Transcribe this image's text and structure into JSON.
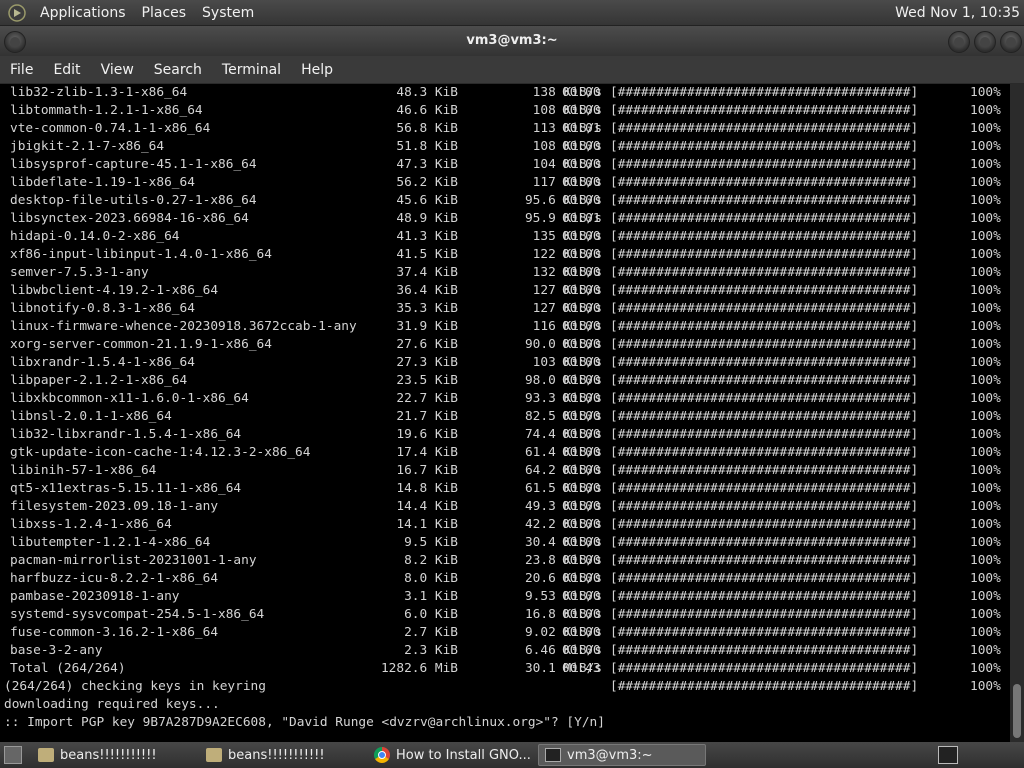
{
  "top_panel": {
    "menus": [
      "Applications",
      "Places",
      "System"
    ],
    "clock": "Wed Nov 1, 10:35"
  },
  "window": {
    "title": "vm3@vm3:~"
  },
  "menubar": {
    "items": [
      "File",
      "Edit",
      "View",
      "Search",
      "Terminal",
      "Help"
    ]
  },
  "terminal": {
    "rows": [
      {
        "pkg": "lib32-zlib-1.3-1-x86_64",
        "size": "48.3 KiB",
        "rate": "138 KiB/s",
        "eta": "00:00",
        "bar": "[######################################]",
        "pct": "100%"
      },
      {
        "pkg": "libtommath-1.2.1-1-x86_64",
        "size": "46.6 KiB",
        "rate": "108 KiB/s",
        "eta": "00:00",
        "bar": "[######################################]",
        "pct": "100%"
      },
      {
        "pkg": "vte-common-0.74.1-1-x86_64",
        "size": "56.8 KiB",
        "rate": "113 KiB/s",
        "eta": "00:01",
        "bar": "[######################################]",
        "pct": "100%"
      },
      {
        "pkg": "jbigkit-2.1-7-x86_64",
        "size": "51.8 KiB",
        "rate": "108 KiB/s",
        "eta": "00:00",
        "bar": "[######################################]",
        "pct": "100%"
      },
      {
        "pkg": "libsysprof-capture-45.1-1-x86_64",
        "size": "47.3 KiB",
        "rate": "104 KiB/s",
        "eta": "00:00",
        "bar": "[######################################]",
        "pct": "100%"
      },
      {
        "pkg": "libdeflate-1.19-1-x86_64",
        "size": "56.2 KiB",
        "rate": "117 KiB/s",
        "eta": "00:00",
        "bar": "[######################################]",
        "pct": "100%"
      },
      {
        "pkg": "desktop-file-utils-0.27-1-x86_64",
        "size": "45.6 KiB",
        "rate": "95.6 KiB/s",
        "eta": "00:00",
        "bar": "[######################################]",
        "pct": "100%"
      },
      {
        "pkg": "libsynctex-2023.66984-16-x86_64",
        "size": "48.9 KiB",
        "rate": "95.9 KiB/s",
        "eta": "00:01",
        "bar": "[######################################]",
        "pct": "100%"
      },
      {
        "pkg": "hidapi-0.14.0-2-x86_64",
        "size": "41.3 KiB",
        "rate": "135 KiB/s",
        "eta": "00:00",
        "bar": "[######################################]",
        "pct": "100%"
      },
      {
        "pkg": "xf86-input-libinput-1.4.0-1-x86_64",
        "size": "41.5 KiB",
        "rate": "122 KiB/s",
        "eta": "00:00",
        "bar": "[######################################]",
        "pct": "100%"
      },
      {
        "pkg": "semver-7.5.3-1-any",
        "size": "37.4 KiB",
        "rate": "132 KiB/s",
        "eta": "00:00",
        "bar": "[######################################]",
        "pct": "100%"
      },
      {
        "pkg": "libwbclient-4.19.2-1-x86_64",
        "size": "36.4 KiB",
        "rate": "127 KiB/s",
        "eta": "00:00",
        "bar": "[######################################]",
        "pct": "100%"
      },
      {
        "pkg": "libnotify-0.8.3-1-x86_64",
        "size": "35.3 KiB",
        "rate": "127 KiB/s",
        "eta": "00:00",
        "bar": "[######################################]",
        "pct": "100%"
      },
      {
        "pkg": "linux-firmware-whence-20230918.3672ccab-1-any",
        "size": "31.9 KiB",
        "rate": "116 KiB/s",
        "eta": "00:00",
        "bar": "[######################################]",
        "pct": "100%"
      },
      {
        "pkg": "xorg-server-common-21.1.9-1-x86_64",
        "size": "27.6 KiB",
        "rate": "90.0 KiB/s",
        "eta": "00:00",
        "bar": "[######################################]",
        "pct": "100%"
      },
      {
        "pkg": "libxrandr-1.5.4-1-x86_64",
        "size": "27.3 KiB",
        "rate": "103 KiB/s",
        "eta": "00:00",
        "bar": "[######################################]",
        "pct": "100%"
      },
      {
        "pkg": "libpaper-2.1.2-1-x86_64",
        "size": "23.5 KiB",
        "rate": "98.0 KiB/s",
        "eta": "00:00",
        "bar": "[######################################]",
        "pct": "100%"
      },
      {
        "pkg": "libxkbcommon-x11-1.6.0-1-x86_64",
        "size": "22.7 KiB",
        "rate": "93.3 KiB/s",
        "eta": "00:00",
        "bar": "[######################################]",
        "pct": "100%"
      },
      {
        "pkg": "libnsl-2.0.1-1-x86_64",
        "size": "21.7 KiB",
        "rate": "82.5 KiB/s",
        "eta": "00:00",
        "bar": "[######################################]",
        "pct": "100%"
      },
      {
        "pkg": "lib32-libxrandr-1.5.4-1-x86_64",
        "size": "19.6 KiB",
        "rate": "74.4 KiB/s",
        "eta": "00:00",
        "bar": "[######################################]",
        "pct": "100%"
      },
      {
        "pkg": "gtk-update-icon-cache-1:4.12.3-2-x86_64",
        "size": "17.4 KiB",
        "rate": "61.4 KiB/s",
        "eta": "00:00",
        "bar": "[######################################]",
        "pct": "100%"
      },
      {
        "pkg": "libinih-57-1-x86_64",
        "size": "16.7 KiB",
        "rate": "64.2 KiB/s",
        "eta": "00:00",
        "bar": "[######################################]",
        "pct": "100%"
      },
      {
        "pkg": "qt5-x11extras-5.15.11-1-x86_64",
        "size": "14.8 KiB",
        "rate": "61.5 KiB/s",
        "eta": "00:00",
        "bar": "[######################################]",
        "pct": "100%"
      },
      {
        "pkg": "filesystem-2023.09.18-1-any",
        "size": "14.4 KiB",
        "rate": "49.3 KiB/s",
        "eta": "00:00",
        "bar": "[######################################]",
        "pct": "100%"
      },
      {
        "pkg": "libxss-1.2.4-1-x86_64",
        "size": "14.1 KiB",
        "rate": "42.2 KiB/s",
        "eta": "00:00",
        "bar": "[######################################]",
        "pct": "100%"
      },
      {
        "pkg": "libutempter-1.2.1-4-x86_64",
        "size": "9.5 KiB",
        "rate": "30.4 KiB/s",
        "eta": "00:00",
        "bar": "[######################################]",
        "pct": "100%"
      },
      {
        "pkg": "pacman-mirrorlist-20231001-1-any",
        "size": "8.2 KiB",
        "rate": "23.8 KiB/s",
        "eta": "00:00",
        "bar": "[######################################]",
        "pct": "100%"
      },
      {
        "pkg": "harfbuzz-icu-8.2.2-1-x86_64",
        "size": "8.0 KiB",
        "rate": "20.6 KiB/s",
        "eta": "00:00",
        "bar": "[######################################]",
        "pct": "100%"
      },
      {
        "pkg": "pambase-20230918-1-any",
        "size": "3.1 KiB",
        "rate": "9.53 KiB/s",
        "eta": "00:00",
        "bar": "[######################################]",
        "pct": "100%"
      },
      {
        "pkg": "systemd-sysvcompat-254.5-1-x86_64",
        "size": "6.0 KiB",
        "rate": "16.8 KiB/s",
        "eta": "00:00",
        "bar": "[######################################]",
        "pct": "100%"
      },
      {
        "pkg": "fuse-common-3.16.2-1-x86_64",
        "size": "2.7 KiB",
        "rate": "9.02 KiB/s",
        "eta": "00:00",
        "bar": "[######################################]",
        "pct": "100%"
      },
      {
        "pkg": "base-3-2-any",
        "size": "2.3 KiB",
        "rate": "6.46 KiB/s",
        "eta": "00:00",
        "bar": "[######################################]",
        "pct": "100%"
      },
      {
        "pkg": "Total (264/264)",
        "size": "1282.6 MiB",
        "rate": "30.1 MiB/s",
        "eta": "00:43",
        "bar": "[######################################]",
        "pct": "100%"
      }
    ],
    "keyring_line": "(264/264) checking keys in keyring",
    "keyring_bar": "[######################################]",
    "keyring_pct": "100%",
    "downloading_line": "downloading required keys...",
    "prompt_line": ":: Import PGP key 9B7A287D9A2EC608, \"David Runge <dvzrv@archlinux.org>\"? [Y/n]"
  },
  "taskbar": {
    "tasks": [
      {
        "label": "beans!!!!!!!!!!!",
        "icon": "folder-icon"
      },
      {
        "label": "beans!!!!!!!!!!!",
        "icon": "folder-icon"
      },
      {
        "label": "How to Install GNO...",
        "icon": "chrome-icon"
      },
      {
        "label": "vm3@vm3:~",
        "icon": "terminal-icon"
      }
    ]
  },
  "colors": {
    "terminal_bg": "#000000",
    "terminal_fg": "#d4d4d4",
    "panel_bg": "#3a3a3a"
  }
}
